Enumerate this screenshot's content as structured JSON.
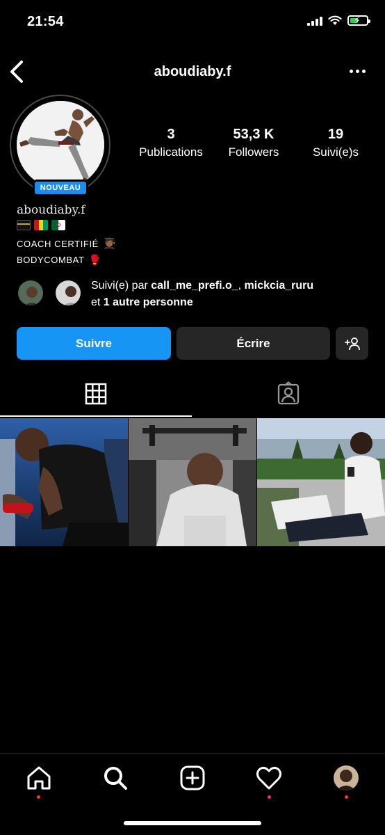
{
  "status_bar": {
    "time": "21:54",
    "icons": [
      "cellular-signal-icon",
      "wifi-icon",
      "battery-charging-icon"
    ]
  },
  "header": {
    "username": "aboudiaby.f",
    "icons": [
      "chevron-left-icon",
      "more-dots-icon"
    ]
  },
  "profile": {
    "badge": "NOUVEAU",
    "stats": [
      {
        "value": "3",
        "label": "Publications"
      },
      {
        "value": "53,3 K",
        "label": "Followers"
      },
      {
        "value": "19",
        "label": "Suivi(e)s"
      }
    ]
  },
  "bio": {
    "name": "aboudiaby.f",
    "emoji_flags": [
      "kaaba-emoji",
      "guinea-flag-emoji",
      "algeria-flag-emoji"
    ],
    "line1": "COACH CERTIFIÉ",
    "line1_emoji": "🧑🏾‍🎓",
    "line2": "BODYCOMBAT",
    "line2_emoji": "🥊"
  },
  "followed_by": {
    "prefix": "Suivi(e) par ",
    "user1": "call_me_prefi.o_",
    "separator": ", ",
    "user2": "mickcia_ruru",
    "middle": " et ",
    "others": "1 autre personne"
  },
  "actions": {
    "follow": "Suivre",
    "message": "Écrire"
  },
  "tabs": [
    "grid-icon",
    "tagged-icon"
  ],
  "posts": [
    {
      "alt": "boxer-wrapping-hands"
    },
    {
      "alt": "man-in-gym-hoodie"
    },
    {
      "alt": "man-on-terrace-with-phone"
    }
  ],
  "bottom_nav": [
    "home-icon",
    "search-icon",
    "create-post-icon",
    "activity-heart-icon",
    "profile-avatar"
  ],
  "colors": {
    "background": "#000000",
    "accent_blue": "#1795f5",
    "button_dark": "#262626",
    "notification_red": "#ff3040"
  }
}
